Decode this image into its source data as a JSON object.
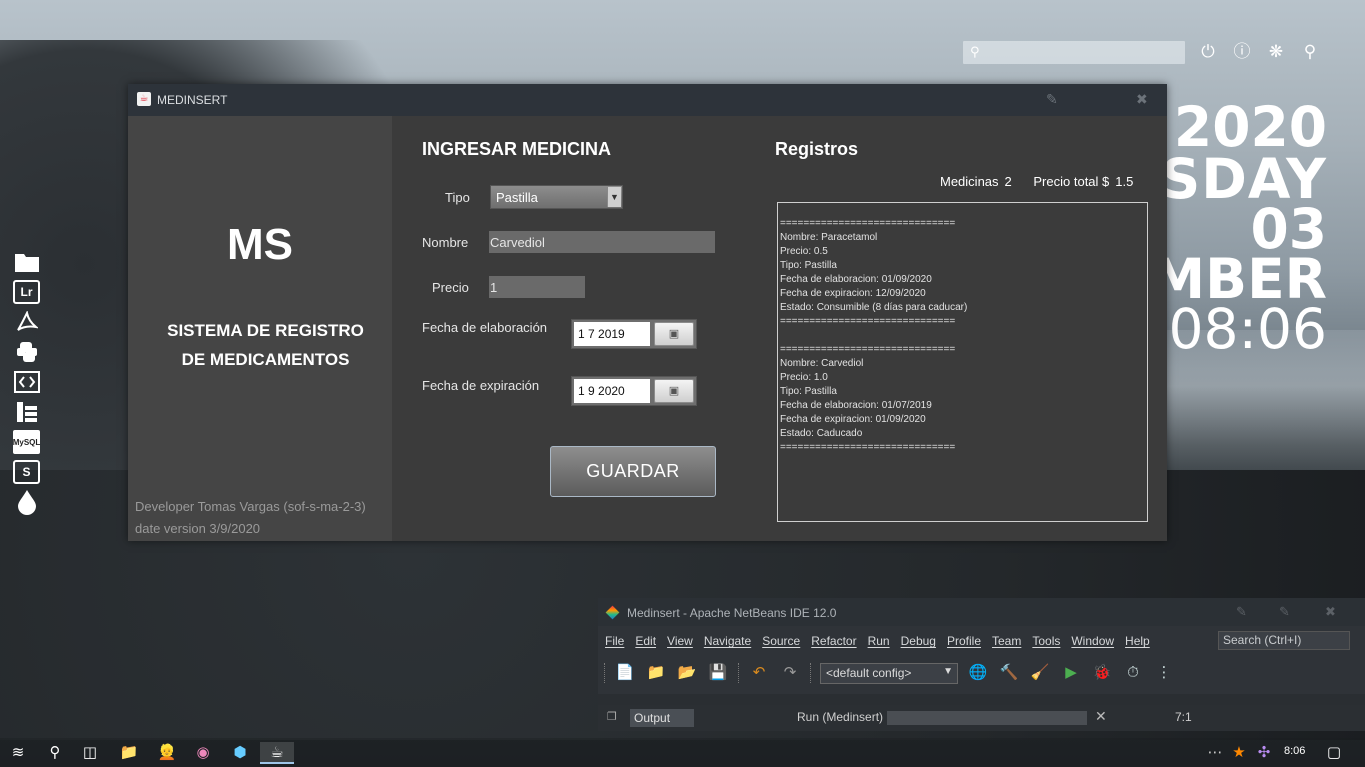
{
  "desktop": {
    "clock": {
      "year": "2020",
      "day_name": "RSDAY",
      "day_number": "03",
      "month": "MBER",
      "time": "08:06"
    }
  },
  "app": {
    "window_title": "MEDINSERT",
    "logo": "MS",
    "subtitle_line1": "SISTEMA DE REGISTRO",
    "subtitle_line2": "DE MEDICAMENTOS",
    "developer": "Developer Tomas Vargas (sof-s-ma-2-3)",
    "date_version": "date version 3/9/2020",
    "form": {
      "title": "INGRESAR MEDICINA",
      "tipo_label": "Tipo",
      "tipo_value": "Pastilla",
      "nombre_label": "Nombre",
      "nombre_value": "Carvediol",
      "precio_label": "Precio",
      "precio_value": "1",
      "elaboracion_label": "Fecha de elaboración",
      "elaboracion_value": "1 7 2019",
      "expiracion_label": "Fecha de expiración",
      "expiracion_value": "1 9 2020",
      "save_label": "GUARDAR"
    },
    "registros": {
      "title": "Registros",
      "medicinas_label": "Medicinas",
      "medicinas_count": "2",
      "precio_total_label": "Precio total $",
      "precio_total_value": "1.5",
      "separator": "==============================",
      "records": [
        {
          "nombre": "Nombre: Paracetamol",
          "precio": "Precio: 0.5",
          "tipo": "Tipo: Pastilla",
          "elaboracion": "Fecha de elaboracion: 01/09/2020",
          "expiracion": "Fecha de expiracion: 12/09/2020",
          "estado": "Estado: Consumible (8 días para caducar)"
        },
        {
          "nombre": "Nombre: Carvediol",
          "precio": "Precio: 1.0",
          "tipo": "Tipo: Pastilla",
          "elaboracion": "Fecha de elaboracion: 01/07/2019",
          "expiracion": "Fecha de expiracion: 01/09/2020",
          "estado": "Estado: Caducado"
        }
      ]
    }
  },
  "netbeans": {
    "title": "Medinsert - Apache NetBeans IDE 12.0",
    "menu": [
      "File",
      "Edit",
      "View",
      "Navigate",
      "Source",
      "Refactor",
      "Run",
      "Debug",
      "Profile",
      "Team",
      "Tools",
      "Window",
      "Help"
    ],
    "search_placeholder": "Search (Ctrl+I)",
    "config": "<default config>",
    "output_tab": "Output",
    "run_status": "Run (Medinsert)",
    "position": "7:1"
  },
  "taskbar": {
    "time": "8:06"
  },
  "dock": {
    "lr_label": "Lr",
    "mysql_label": "MySQL",
    "s_label": "S"
  }
}
